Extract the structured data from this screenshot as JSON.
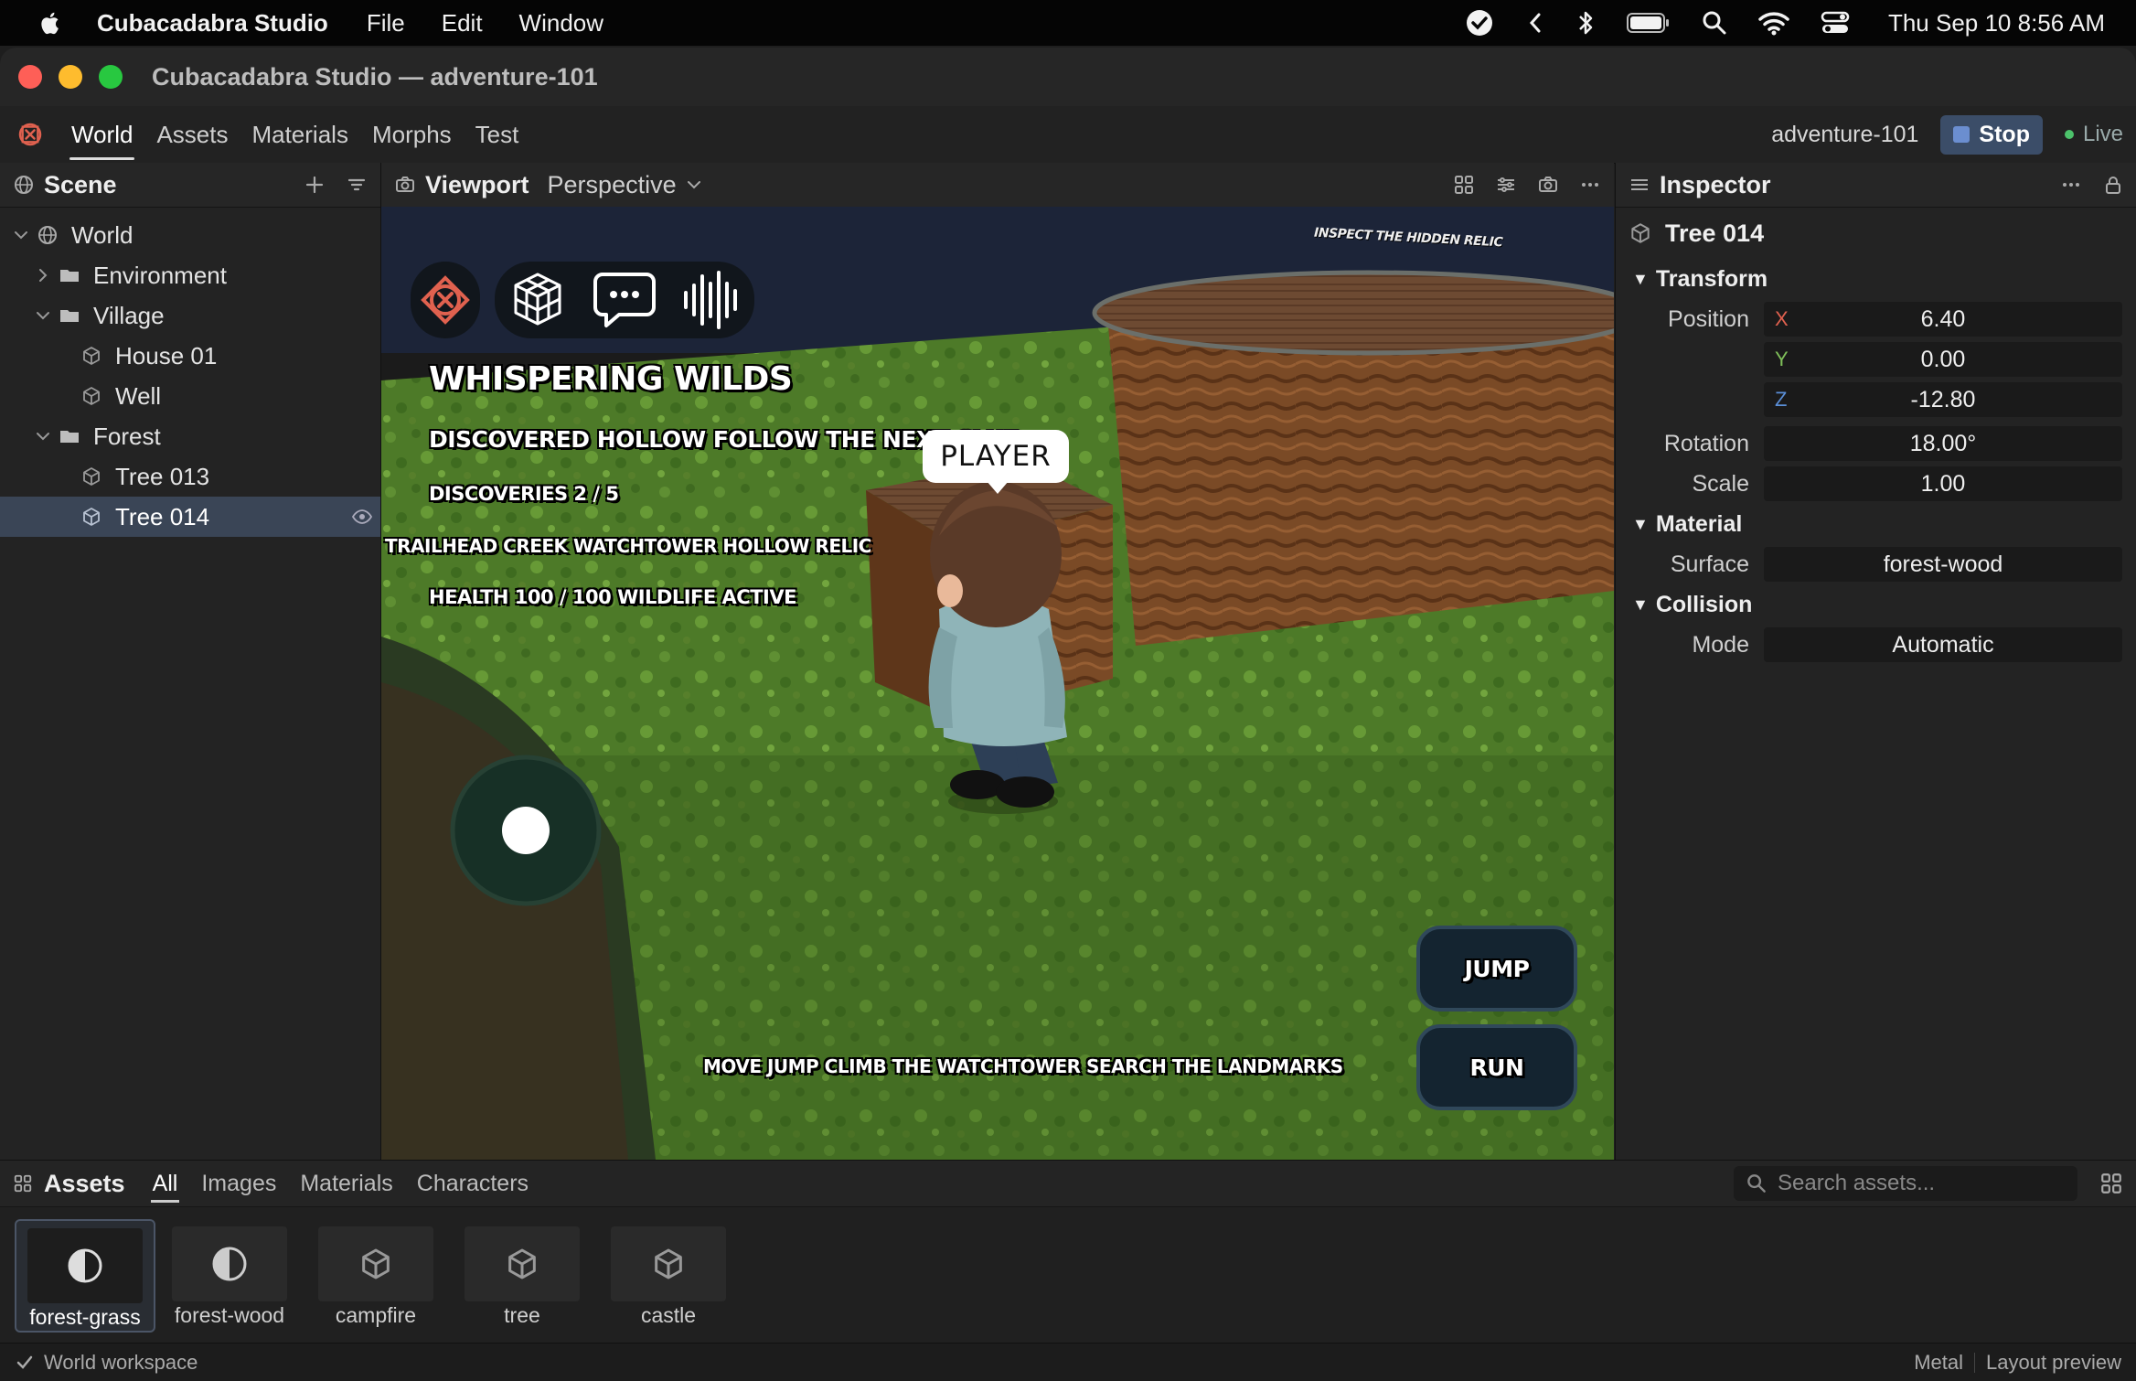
{
  "menubar": {
    "app_name": "Cubacadabra Studio",
    "menus": [
      "File",
      "Edit",
      "Window"
    ],
    "clock": "Thu Sep 10  8:56 AM"
  },
  "window": {
    "title": "Cubacadabra Studio — adventure-101"
  },
  "toolbar": {
    "tabs": [
      "World",
      "Assets",
      "Materials",
      "Morphs",
      "Test"
    ],
    "active_tab": "World",
    "project": "adventure-101",
    "stop_label": "Stop",
    "live_label": "Live"
  },
  "scene": {
    "title": "Scene",
    "items": [
      {
        "label": "World",
        "depth": 0,
        "expanded": true,
        "type": "globe"
      },
      {
        "label": "Environment",
        "depth": 1,
        "expanded": false,
        "type": "folder"
      },
      {
        "label": "Village",
        "depth": 1,
        "expanded": true,
        "type": "folder"
      },
      {
        "label": "House 01",
        "depth": 2,
        "type": "cube"
      },
      {
        "label": "Well",
        "depth": 2,
        "type": "cube"
      },
      {
        "label": "Forest",
        "depth": 1,
        "expanded": true,
        "type": "folder"
      },
      {
        "label": "Tree 013",
        "depth": 2,
        "type": "cube"
      },
      {
        "label": "Tree 014",
        "depth": 2,
        "type": "cube",
        "selected": true
      }
    ]
  },
  "viewport": {
    "title": "Viewport",
    "mode": "Perspective"
  },
  "game": {
    "sign_text": "INSPECT THE HIDDEN RELIC",
    "hud_title": "WHISPERING WILDS",
    "objective": "DISCOVERED HOLLOW  FOLLOW THE NEXT CLUE",
    "discoveries": "DISCOVERIES 2 / 5",
    "landmarks": "TRAILHEAD  CREEK  WATCHTOWER  HOLLOW  RELIC",
    "status_line": "HEALTH 100 / 100 WILDLIFE ACTIVE",
    "player_label": "PLAYER",
    "jump_label": "JUMP",
    "run_label": "RUN",
    "help_text": "MOVE  JUMP  CLIMB THE WATCHTOWER  SEARCH THE LANDMARKS"
  },
  "inspector": {
    "title": "Inspector",
    "object_name": "Tree 014",
    "transform_label": "Transform",
    "position_label": "Position",
    "position": {
      "x": "6.40",
      "y": "0.00",
      "z": "-12.80"
    },
    "axis_x": "X",
    "axis_y": "Y",
    "axis_z": "Z",
    "axis_colors": {
      "x": "#e0614f",
      "y": "#7fbf5a",
      "z": "#5b8fd8"
    },
    "rotation_label": "Rotation",
    "rotation": "18.00°",
    "scale_label": "Scale",
    "scale": "1.00",
    "material_label": "Material",
    "surface_label": "Surface",
    "surface": "forest-wood",
    "collision_label": "Collision",
    "mode_label": "Mode",
    "mode": "Automatic"
  },
  "assets": {
    "title": "Assets",
    "tabs": [
      "All",
      "Images",
      "Materials",
      "Characters"
    ],
    "active_tab": "All",
    "search_placeholder": "Search assets...",
    "items": [
      {
        "label": "forest-grass",
        "icon": "half-circle-icon",
        "selected": true
      },
      {
        "label": "forest-wood",
        "icon": "half-circle-icon"
      },
      {
        "label": "campfire",
        "icon": "cube-icon"
      },
      {
        "label": "tree",
        "icon": "cube-icon"
      },
      {
        "label": "castle",
        "icon": "cube-icon"
      }
    ]
  },
  "statusbar": {
    "left": "World workspace",
    "renderer": "Metal",
    "preview": "Layout preview"
  },
  "colors": {
    "accent_red": "#e0614f",
    "selection": "#3a4556",
    "live": "#4cc26b"
  }
}
